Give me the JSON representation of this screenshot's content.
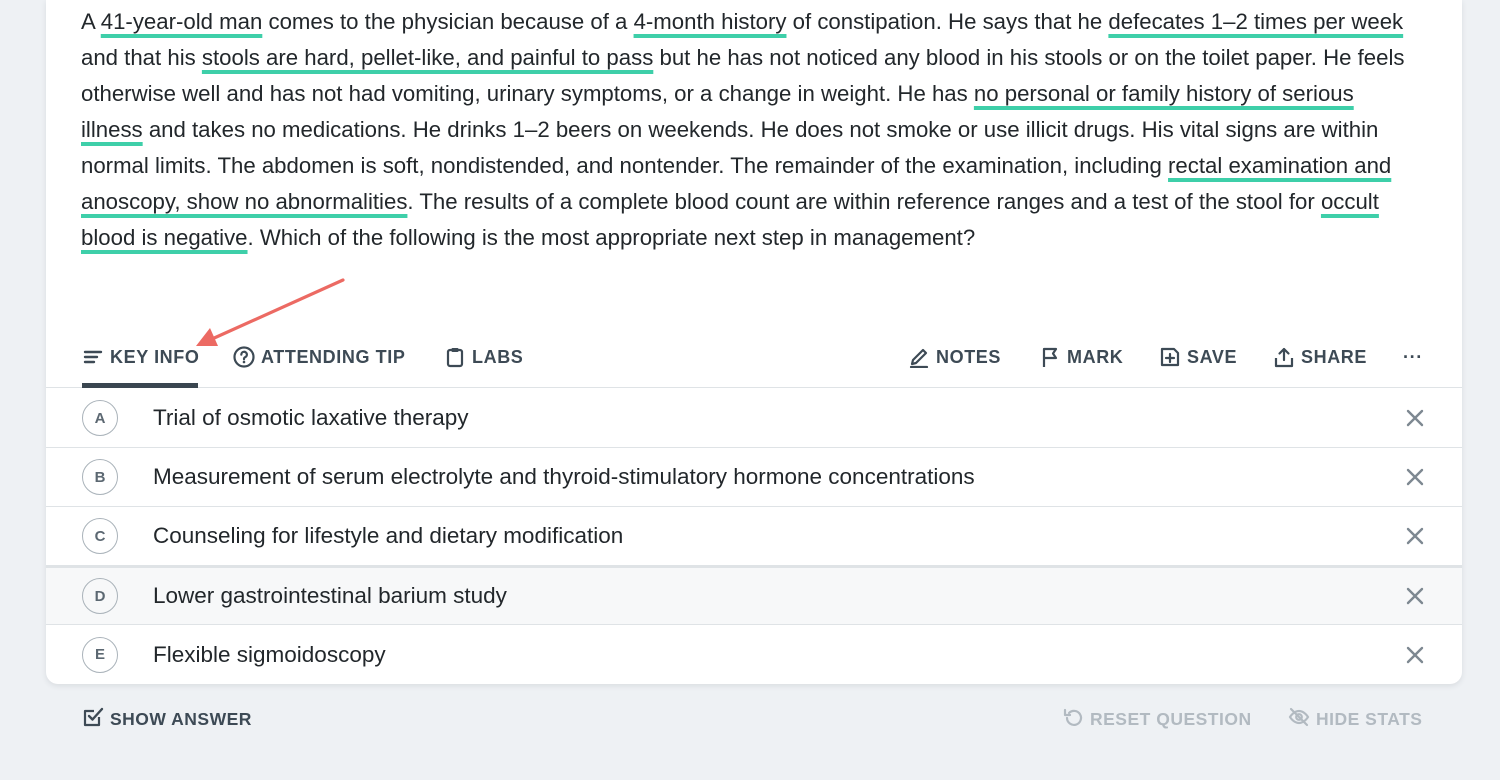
{
  "question": {
    "segments": [
      {
        "text": "A ",
        "hl": false
      },
      {
        "text": "41-year-old man",
        "hl": true
      },
      {
        "text": " comes to the physician because of a ",
        "hl": false
      },
      {
        "text": "4-month history",
        "hl": true
      },
      {
        "text": " of constipation. He says that he ",
        "hl": false
      },
      {
        "text": "defecates 1–2 times per week",
        "hl": true
      },
      {
        "text": " and that his ",
        "hl": false
      },
      {
        "text": "stools are hard, pellet-like, and painful to pass",
        "hl": true
      },
      {
        "text": " but he has not noticed any blood in his stools or on the toilet paper. He feels otherwise well and has not had vomiting, urinary symptoms, or a change in weight. He has ",
        "hl": false
      },
      {
        "text": "no personal or family history of serious illness",
        "hl": true
      },
      {
        "text": " and takes no medications. He drinks 1–2 beers on weekends. He does not smoke or use illicit drugs. His vital signs are within normal limits. The abdomen is soft, nondistended, and nontender. The remainder of the examination, including ",
        "hl": false
      },
      {
        "text": "rectal examination and anoscopy, show no abnormalities",
        "hl": true
      },
      {
        "text": ". The results of a complete blood count are within reference ranges and a test of the stool for ",
        "hl": false
      },
      {
        "text": "occult blood is negative",
        "hl": true
      },
      {
        "text": ". Which of the following is the most appropriate next step in management?",
        "hl": false
      }
    ]
  },
  "tabs": {
    "key_info": "KEY INFO",
    "attending_tip": "ATTENDING TIP",
    "labs": "LABS",
    "notes": "NOTES",
    "mark": "MARK",
    "save": "SAVE",
    "share": "SHARE",
    "more": "···"
  },
  "options": [
    {
      "letter": "A",
      "text": "Trial of osmotic laxative therapy"
    },
    {
      "letter": "B",
      "text": "Measurement of serum electrolyte and thyroid-stimulatory hormone concentrations"
    },
    {
      "letter": "C",
      "text": "Counseling for lifestyle and dietary modification"
    },
    {
      "letter": "D",
      "text": "Lower gastrointestinal barium study"
    },
    {
      "letter": "E",
      "text": "Flexible sigmoidoscopy"
    }
  ],
  "footer": {
    "show_answer": "SHOW ANSWER",
    "reset_question": "RESET QUESTION",
    "hide_stats": "HIDE STATS"
  },
  "colors": {
    "highlight": "#3ecfa9",
    "arrow": "#ec6a63",
    "active_tab": "#3a4650",
    "disabled": "#aab3ba"
  },
  "icons": {
    "key_info": "lines-icon",
    "attending_tip": "question-circle-icon",
    "labs": "clipboard-icon",
    "notes": "pencil-icon",
    "mark": "flag-icon",
    "save": "save-plus-icon",
    "share": "share-upload-icon",
    "show_answer": "check-square-icon",
    "reset_question": "undo-icon",
    "hide_stats": "eye-off-icon"
  }
}
